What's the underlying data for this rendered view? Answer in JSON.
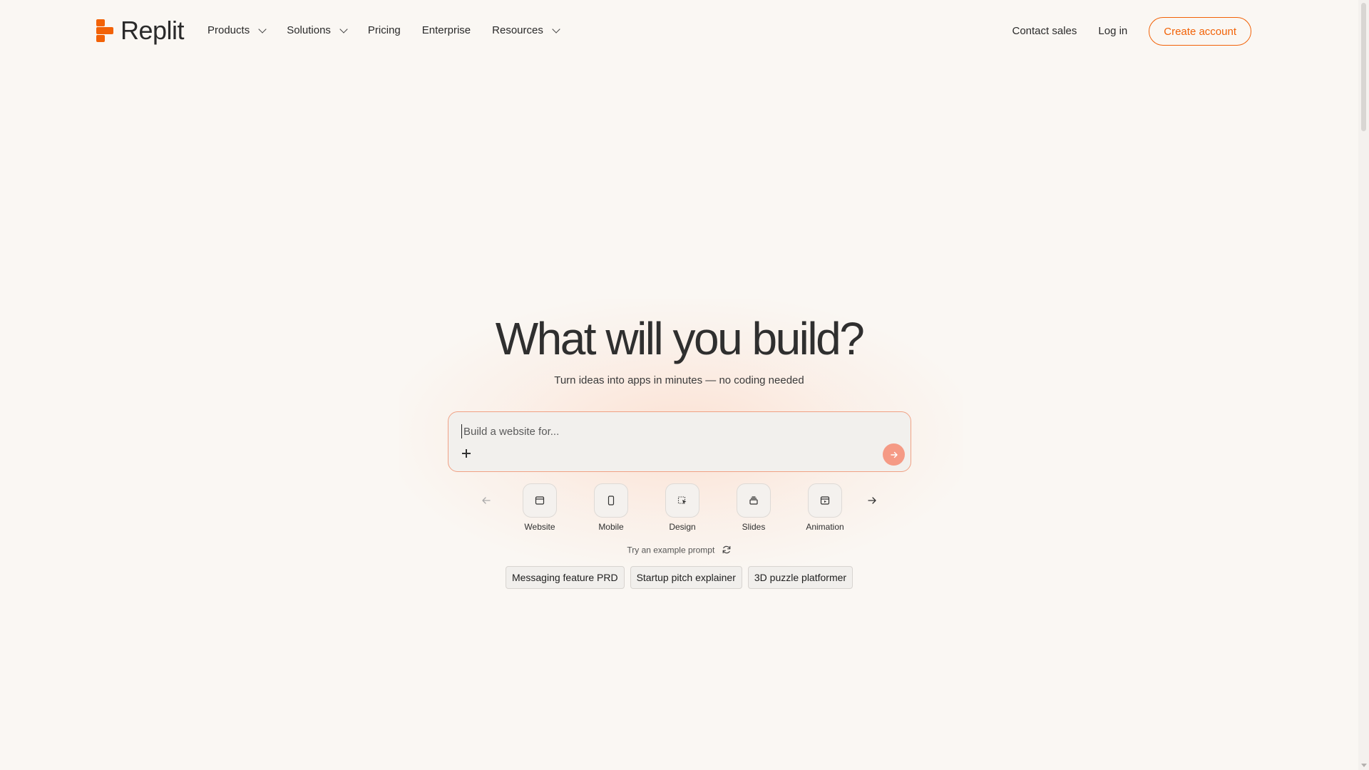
{
  "header": {
    "logo_text": "Replit",
    "nav": [
      {
        "label": "Products",
        "has_dropdown": true
      },
      {
        "label": "Solutions",
        "has_dropdown": true
      },
      {
        "label": "Pricing",
        "has_dropdown": false
      },
      {
        "label": "Enterprise",
        "has_dropdown": false
      },
      {
        "label": "Resources",
        "has_dropdown": true
      }
    ],
    "contact_sales": "Contact sales",
    "log_in": "Log in",
    "create_account": "Create account"
  },
  "hero": {
    "title": "What will you build?",
    "subtitle": "Turn ideas into apps in minutes — no coding needed"
  },
  "prompt": {
    "placeholder": "Build a website for...",
    "value": ""
  },
  "categories": [
    {
      "label": "Website",
      "icon": "browser-window-icon"
    },
    {
      "label": "Mobile",
      "icon": "phone-icon"
    },
    {
      "label": "Design",
      "icon": "design-select-icon"
    },
    {
      "label": "Slides",
      "icon": "slides-stack-icon"
    },
    {
      "label": "Animation",
      "icon": "play-window-icon"
    }
  ],
  "examples": {
    "label": "Try an example prompt",
    "chips": [
      "Messaging feature PRD",
      "Startup pitch explainer",
      "3D puzzle platformer"
    ]
  },
  "colors": {
    "accent": "#f26207",
    "background": "#faf7f3",
    "send_button": "#f59a85"
  }
}
